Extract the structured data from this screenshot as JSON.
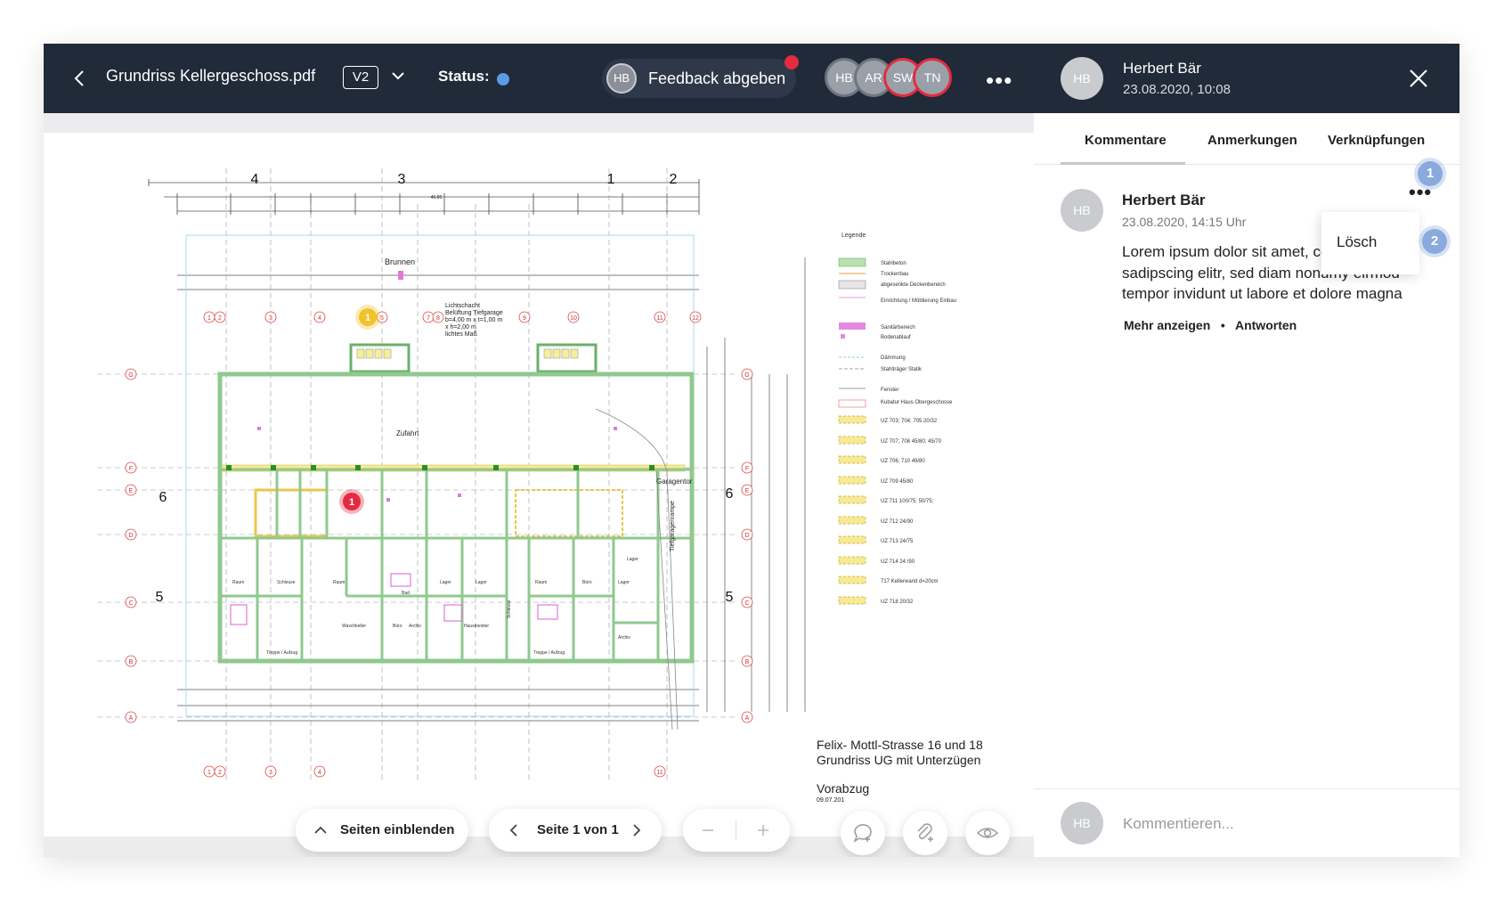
{
  "toolbar": {
    "filename": "Grundriss Kellergeschoss.pdf",
    "version": "V2",
    "status_label": "Status:",
    "status_color": "#5b9ae6",
    "feedback_label": "Feedback abgeben",
    "feedback_avatar": "HB",
    "users": [
      "HB",
      "AR",
      "SW",
      "TN"
    ],
    "more_label": "•••"
  },
  "plan": {
    "grid_top": [
      "4",
      "3",
      "1",
      "2"
    ],
    "grid_side": [
      "6",
      "5"
    ],
    "dimension_total": "46,80",
    "room_brunnen": "Brunnen",
    "lichtschacht": [
      "Lichtschacht",
      "Belüftung Tiefgarage",
      "b=4,00 m x t=1,00 m",
      "x h=2,00 m",
      "lichtes Maß"
    ],
    "zufahrt": "Zufahrt",
    "garagentor": "Garagentor",
    "tiefgarage": "Tiefgaragenrampe",
    "axis_rows": [
      "G",
      "F",
      "E",
      "D",
      "C",
      "B",
      "A"
    ],
    "axis_cols_top": [
      "1",
      "2",
      "3",
      "4",
      "5",
      "7",
      "8",
      "9",
      "10",
      "11",
      "12"
    ],
    "axis_cols_bottom": [
      "1",
      "2",
      "3",
      "4",
      "11"
    ],
    "rooms": [
      "Raum",
      "Schleuse",
      "Raum",
      "Bad",
      "Lager",
      "Lager",
      "Raum",
      "Büro",
      "Lager",
      "Treppe / Aufzug",
      "Waschkeller",
      "Büro",
      "Archiv",
      "Hausmeister",
      "Treppe / Aufzug",
      "Schleuse",
      "Archiv",
      "Lager"
    ],
    "legend": {
      "title": "Legende",
      "items": [
        {
          "label": "Stahlbeton",
          "kind": "green"
        },
        {
          "label": "Trockenbau",
          "kind": "orange-line"
        },
        {
          "label": "abgesenkte Deckenbereich",
          "kind": "grey"
        },
        {
          "label": "Einrichtung / Möblierung Einbau",
          "kind": "pink-line"
        },
        {
          "label": "Sanitärbereich",
          "kind": "magenta"
        },
        {
          "label": "Bodenablauf",
          "kind": "magenta-small"
        },
        {
          "label": "Dämmung",
          "kind": "cyan-line"
        },
        {
          "label": "Stahlträger Statik",
          "kind": "dash"
        },
        {
          "label": "Fenster",
          "kind": "line"
        },
        {
          "label": "Kubatur Haus Obergeschosse",
          "kind": "red-box"
        },
        {
          "label": "UZ 703; 704; 705   20/32",
          "kind": "yellow"
        },
        {
          "label": "UZ 707; 708   45/80; 45/70",
          "kind": "yellow"
        },
        {
          "label": "UZ 706; 710   49/80",
          "kind": "yellow"
        },
        {
          "label": "UZ 709   45/80",
          "kind": "yellow"
        },
        {
          "label": "UZ 711   100/75; 50/75;",
          "kind": "yellow"
        },
        {
          "label": "UZ 712   24/90",
          "kind": "yellow"
        },
        {
          "label": "UZ 713   24/75",
          "kind": "yellow"
        },
        {
          "label": "UZ 714   24 /90",
          "kind": "yellow"
        },
        {
          "label": "717  Kellerwand d=20cm",
          "kind": "yellow"
        },
        {
          "label": "UZ 718   20/32",
          "kind": "yellow"
        }
      ]
    },
    "address_line1": "Felix- Mottl-Strasse 16 und 18",
    "address_line2": "Grundriss UG mit Unterzügen",
    "stage": "Vorabzug",
    "stage_date": "09.07.201",
    "marker_yellow": "1",
    "marker_red": "1",
    "yellow_color": "#f2c22a",
    "red_color": "#e32b3f"
  },
  "controls": {
    "pages_label": "Seiten einblenden",
    "page_label": "Seite 1 von 1"
  },
  "panel": {
    "author": "Herbert Bär",
    "author_initials": "HB",
    "datetime": "23.08.2020, 10:08",
    "tabs": [
      "Kommentare",
      "Anmerkungen",
      "Verknüpfungen"
    ],
    "comment": {
      "author": "Herbert Bär",
      "initials": "HB",
      "time": "23.08.2020, 14:15 Uhr",
      "body_lines": [
        "Lorem ipsum dolor sit amet, conset",
        "sadipscing elitr, sed diam nonumy eirmod",
        "tempor invidunt ut labore et dolore magna"
      ],
      "more_label": "Mehr anzeigen",
      "reply_label": "Antworten",
      "menu_label": "•••"
    },
    "popup_label": "Lösch",
    "badges": [
      "1",
      "2"
    ],
    "compose_initials": "HB",
    "compose_placeholder": "Kommentieren..."
  }
}
